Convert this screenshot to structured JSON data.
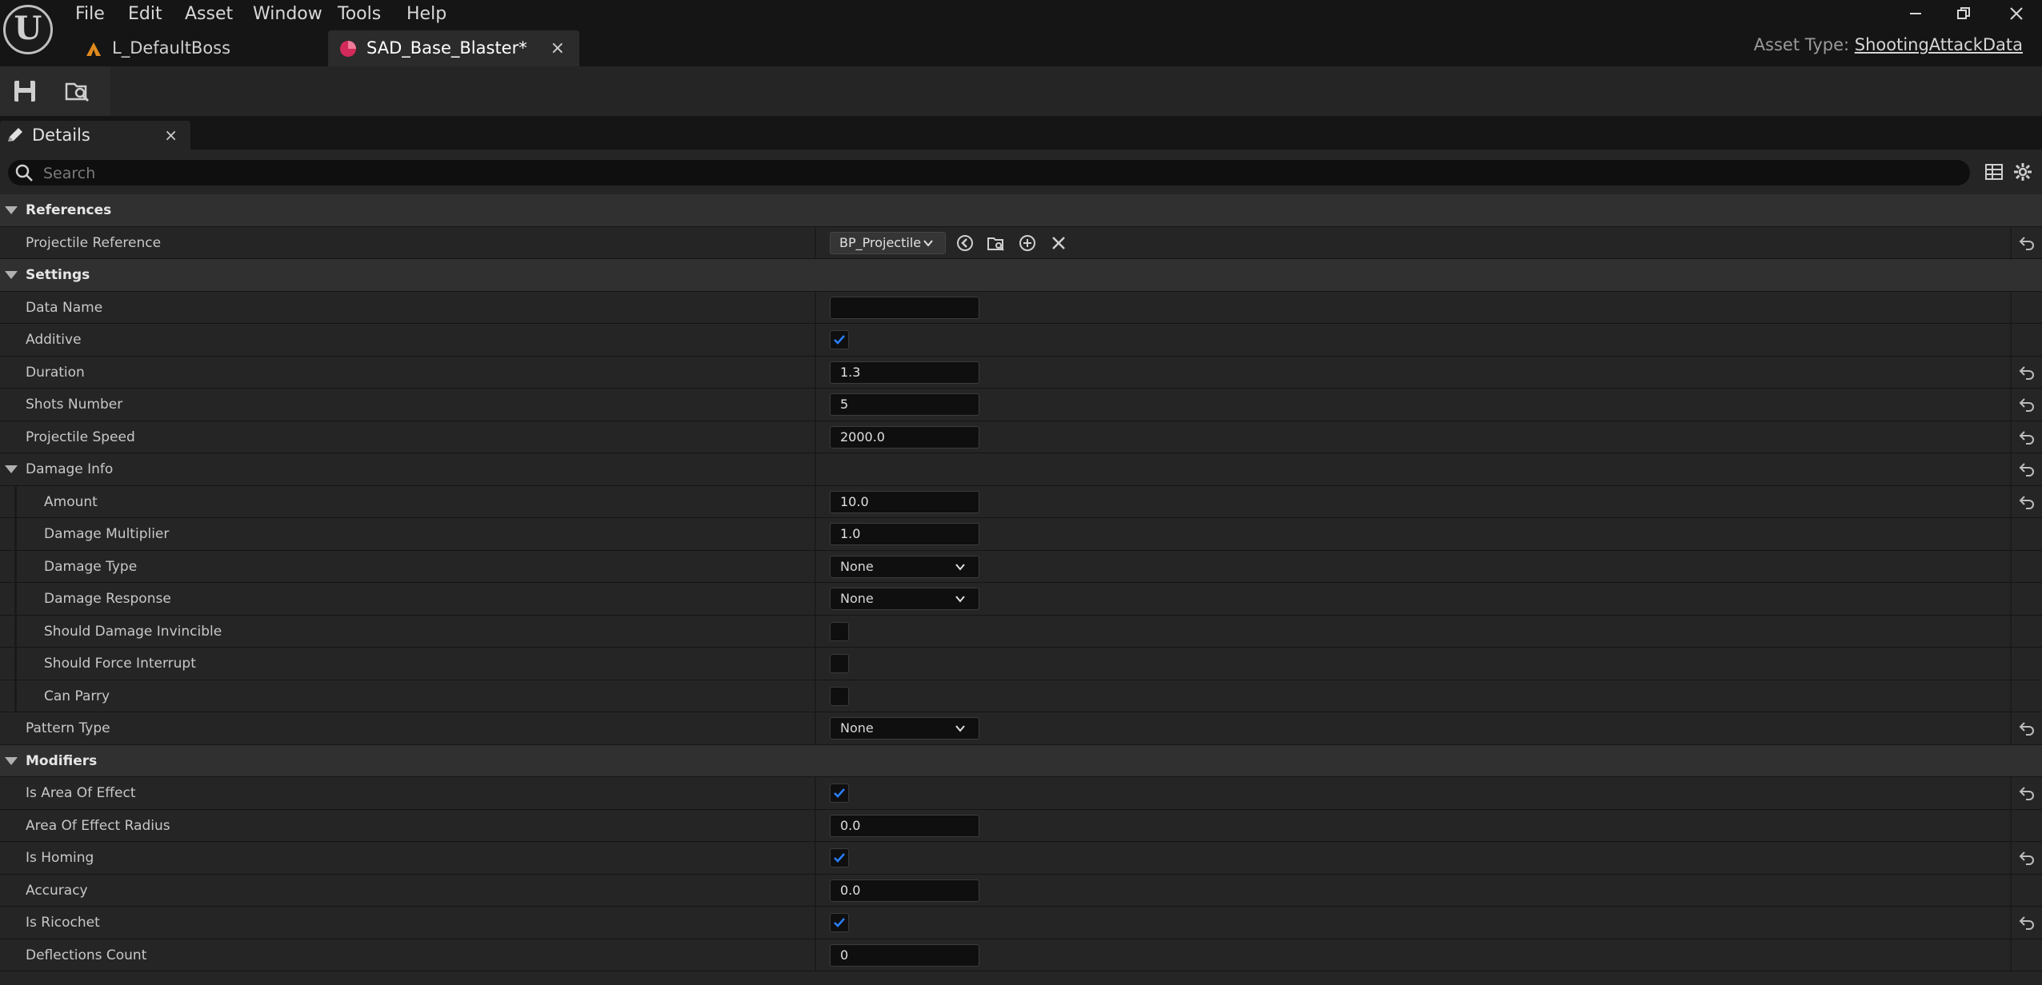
{
  "menu": [
    "File",
    "Edit",
    "Asset",
    "Window",
    "Tools",
    "Help"
  ],
  "tabs": [
    {
      "label": "L_DefaultBoss"
    },
    {
      "label": "SAD_Base_Blaster*"
    }
  ],
  "tab_close_glyph": "×",
  "asset_type": {
    "prefix": "Asset Type:",
    "value": "ShootingAttackData"
  },
  "details_tab": {
    "label": "Details",
    "close": "×"
  },
  "search": {
    "placeholder": "Search",
    "value": ""
  },
  "colors": {
    "accent_check": "#2a7fff",
    "background": "#252525",
    "category": "#303030"
  },
  "rows": {
    "references": "References",
    "projectile_reference": {
      "label": "Projectile Reference",
      "value": "BP_Projectile"
    },
    "settings": "Settings",
    "data_name": {
      "label": "Data Name",
      "value": ""
    },
    "additive": {
      "label": "Additive",
      "checked": true
    },
    "duration": {
      "label": "Duration",
      "value": "1.3"
    },
    "shots_number": {
      "label": "Shots Number",
      "value": "5"
    },
    "projectile_speed": {
      "label": "Projectile Speed",
      "value": "2000.0"
    },
    "damage_info": "Damage Info",
    "amount": {
      "label": "Amount",
      "value": "10.0"
    },
    "damage_multiplier": {
      "label": "Damage Multiplier",
      "value": "1.0"
    },
    "damage_type": {
      "label": "Damage Type",
      "value": "None"
    },
    "damage_response": {
      "label": "Damage Response",
      "value": "None"
    },
    "should_damage_invincible": {
      "label": "Should Damage Invincible",
      "checked": false
    },
    "should_force_interrupt": {
      "label": "Should Force Interrupt",
      "checked": false
    },
    "can_parry": {
      "label": "Can Parry",
      "checked": false
    },
    "pattern_type": {
      "label": "Pattern Type",
      "value": "None"
    },
    "modifiers": "Modifiers",
    "is_area_of_effect": {
      "label": "Is Area Of Effect",
      "checked": true
    },
    "area_of_effect_radius": {
      "label": "Area Of Effect Radius",
      "value": "0.0"
    },
    "is_homing": {
      "label": "Is Homing",
      "checked": true
    },
    "accuracy": {
      "label": "Accuracy",
      "value": "0.0"
    },
    "is_ricochet": {
      "label": "Is Ricochet",
      "checked": true
    },
    "deflections_count": {
      "label": "Deflections Count",
      "value": "0"
    }
  }
}
